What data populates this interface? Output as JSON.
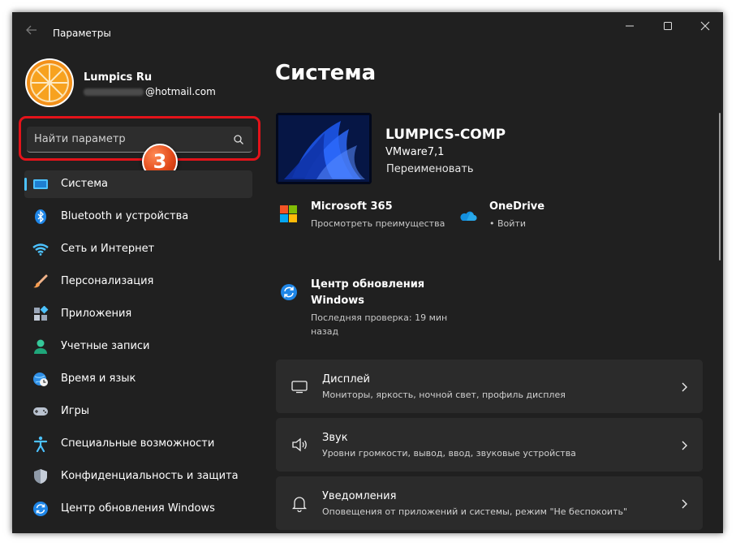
{
  "window": {
    "title": "Параметры"
  },
  "user": {
    "name": "Lumpics Ru",
    "email_domain": "@hotmail.com"
  },
  "search": {
    "placeholder": "Найти параметр"
  },
  "annotation": {
    "step": "3",
    "highlight_color": "#e3131a"
  },
  "nav": {
    "items": [
      {
        "label": "Система",
        "icon": "display-icon",
        "active": true
      },
      {
        "label": "Bluetooth и устройства",
        "icon": "bluetooth-icon"
      },
      {
        "label": "Сеть и Интернет",
        "icon": "wifi-icon"
      },
      {
        "label": "Персонализация",
        "icon": "brush-icon"
      },
      {
        "label": "Приложения",
        "icon": "apps-icon"
      },
      {
        "label": "Учетные записи",
        "icon": "account-icon"
      },
      {
        "label": "Время и язык",
        "icon": "globe-clock-icon"
      },
      {
        "label": "Игры",
        "icon": "gamepad-icon"
      },
      {
        "label": "Специальные возможности",
        "icon": "accessibility-icon"
      },
      {
        "label": "Конфиденциальность и защита",
        "icon": "shield-icon"
      },
      {
        "label": "Центр обновления Windows",
        "icon": "update-icon"
      }
    ]
  },
  "main": {
    "title": "Система",
    "device": {
      "name": "LUMPICS-COMP",
      "model": "VMware7,1",
      "rename": "Переименовать"
    },
    "tiles": {
      "m365": {
        "title": "Microsoft 365",
        "subtitle": "Просмотреть преимущества"
      },
      "onedrive": {
        "title": "OneDrive",
        "subtitle": "• Войти"
      },
      "update": {
        "title_line1": "Центр обновления",
        "title_line2": "Windows",
        "subtitle_line1": "Последняя проверка: 19 мин",
        "subtitle_line2": "назад"
      }
    },
    "cards": [
      {
        "title": "Дисплей",
        "subtitle": "Мониторы, яркость, ночной свет, профиль дисплея",
        "icon": "monitor-icon"
      },
      {
        "title": "Звук",
        "subtitle": "Уровни громкости, вывод, ввод, звуковые устройства",
        "icon": "speaker-icon"
      },
      {
        "title": "Уведомления",
        "subtitle": "Оповещения от приложений и системы, режим \"Не беспокоить\"",
        "icon": "bell-icon"
      }
    ]
  },
  "colors": {
    "accent": "#4cc2ff",
    "background": "#202020",
    "card": "#2b2b2b"
  }
}
